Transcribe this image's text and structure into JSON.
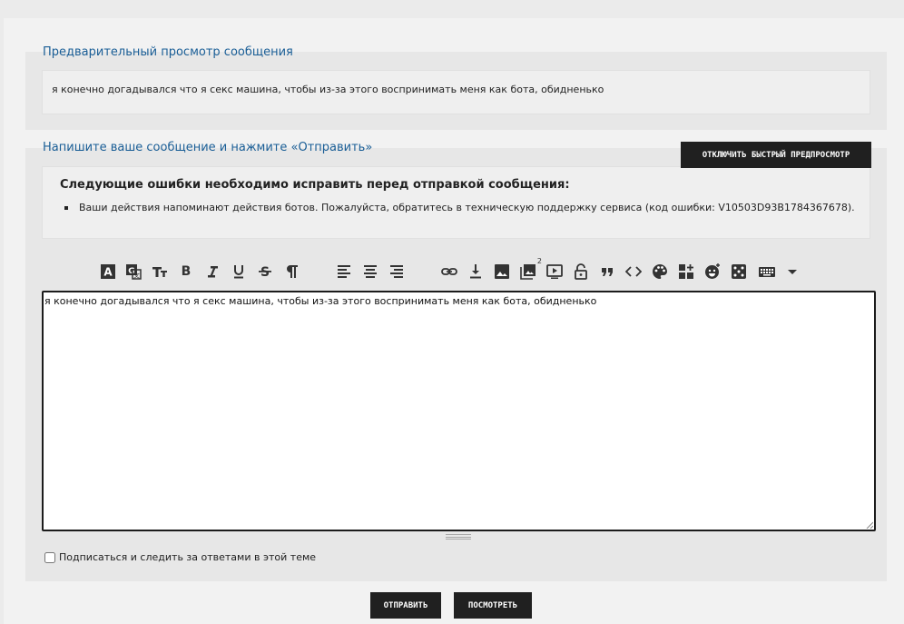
{
  "preview": {
    "title": "Предварительный просмотр сообщения",
    "content": "я конечно догадывался что я секс машина, чтобы из-за этого воспринимать меня как бота, обидненько"
  },
  "editor": {
    "title": "Напишите ваше сообщение и нажмите «Отправить»",
    "fast_preview_button": "ОТКЛЮЧИТЬ БЫСТРЫЙ ПРЕДПРОСМОТР",
    "errors": {
      "title": "Следующие ошибки необходимо исправить перед отправкой сообщения:",
      "items": [
        "Ваши действия напоминают действия ботов. Пожалуйста, обратитесь в техническую поддержку сервиса (код ошибки: V10503D93B1784367678)."
      ]
    },
    "toolbar": {
      "icons": [
        "font-color-icon",
        "translate-icon",
        "font-size-icon",
        "bold-icon",
        "italic-icon",
        "underline-icon",
        "strikethrough-icon",
        "paragraph-icon",
        "align-left-icon",
        "align-center-icon",
        "align-right-icon",
        "link-icon",
        "download-icon",
        "image-icon",
        "gallery-icon",
        "video-icon",
        "lock-icon",
        "quote-icon",
        "code-icon",
        "palette-icon",
        "widgets-icon",
        "emoji-icon",
        "dice-icon",
        "keyboard-icon",
        "more-icon"
      ],
      "gallery_badge": "2"
    },
    "textarea_value": "я конечно догадывался что я секс машина, чтобы из-за этого воспринимать меня как бота, обидненько",
    "subscribe_label": "Подписаться и следить за ответами в этой теме"
  },
  "actions": {
    "submit_label": "ОТПРАВИТЬ",
    "preview_label": "ПОСМОТРЕТЬ"
  },
  "colors": {
    "accent_link": "#1a5e96",
    "button_bg": "#202020"
  }
}
